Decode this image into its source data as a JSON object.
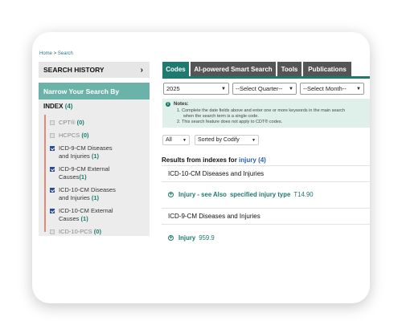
{
  "breadcrumb": {
    "home": "Home",
    "sep": " > ",
    "current": "Search"
  },
  "left": {
    "search_history": "SEARCH HISTORY",
    "narrow": "Narrow Your Search By",
    "index_label": "INDEX",
    "index_count": "(4)",
    "items": [
      {
        "label": "CPT®",
        "count": "(0)",
        "checked": false
      },
      {
        "label": "HCPCS",
        "count": "(0)",
        "checked": false
      },
      {
        "label": "ICD-9-CM Diseases",
        "label2": "and Injuries",
        "count": "(1)",
        "checked": true
      },
      {
        "label": "ICD-9-CM External",
        "label2": "Causes",
        "count": "(1)",
        "checked": true
      },
      {
        "label": "ICD-10-CM Diseases",
        "label2": "and Injuries",
        "count": "(1)",
        "checked": true
      },
      {
        "label": "ICD-10-CM External",
        "label2": "Causes",
        "count": "(1)",
        "checked": true
      },
      {
        "label": "ICD-10-PCS",
        "count": "(0)",
        "checked": false
      }
    ]
  },
  "tabs": [
    "Codes",
    "AI-powered Smart Search",
    "Tools",
    "Publications"
  ],
  "filters": {
    "year": "2025",
    "quarter": "--Select Quarter--",
    "month": "--Select Month--"
  },
  "notes": {
    "title": "Notes:",
    "n1": "1. Complete the date fields above and enter one or more keywords in the main search",
    "n1b": "when the search term is a single code.",
    "n2": "2. This search feature does not apply to CDT® codes."
  },
  "sort": {
    "scope": "All",
    "order": "Sorted by Codify"
  },
  "results": {
    "prefix": "Results from indexes for",
    "query": "injury",
    "count": "(4)",
    "groups": [
      {
        "title": "ICD-10-CM Diseases and Injuries",
        "entry": "Injury - see Also",
        "link": "specified injury type",
        "code": "T14.90"
      },
      {
        "title": "ICD-9-CM Diseases and Injuries",
        "entry": "Injury",
        "code": "959.9"
      }
    ]
  },
  "colors": {
    "teal": "#1e7a6e",
    "narrow_bg": "#6bb3a8",
    "tab_inactive": "#555555",
    "accent_rail": "#e08a77"
  }
}
